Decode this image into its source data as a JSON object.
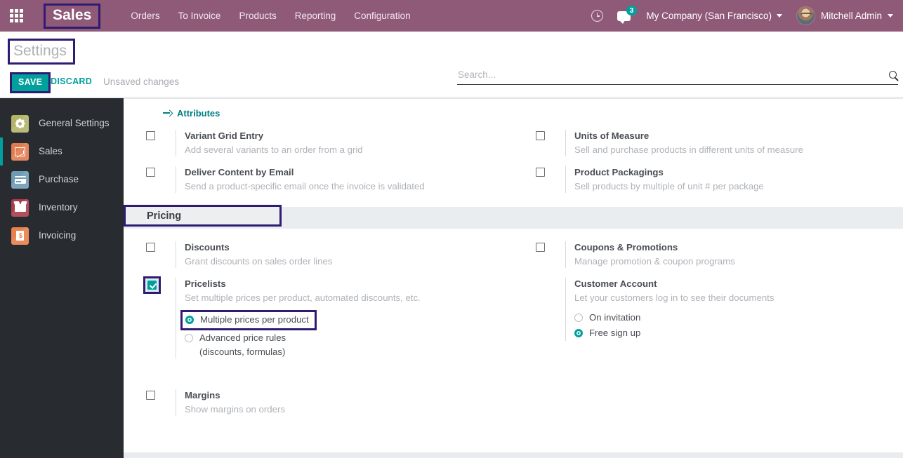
{
  "navbar": {
    "apps_icon": "apps-grid-icon",
    "brand": "Sales",
    "menu": [
      {
        "label": "Orders"
      },
      {
        "label": "To Invoice"
      },
      {
        "label": "Products"
      },
      {
        "label": "Reporting"
      },
      {
        "label": "Configuration"
      }
    ],
    "activity_icon": "clock-icon",
    "messages_icon": "chat-bubble-icon",
    "messages_count": "3",
    "company": "My Company (San Francisco)",
    "user": "Mitchell Admin",
    "accent_color": "#8f5a78",
    "badge_color": "#00a09d"
  },
  "control_panel": {
    "title": "Settings",
    "save_label": "SAVE",
    "discard_label": "DISCARD",
    "unsaved_note": "Unsaved changes",
    "search_placeholder": "Search...",
    "search_value": "",
    "search_icon": "magnifier-icon"
  },
  "sidebar": {
    "items": [
      {
        "label": "General Settings",
        "icon": "gear-icon",
        "active": false
      },
      {
        "label": "Sales",
        "icon": "sales-chart-icon",
        "active": true
      },
      {
        "label": "Purchase",
        "icon": "credit-card-icon",
        "active": false
      },
      {
        "label": "Inventory",
        "icon": "open-box-icon",
        "active": false
      },
      {
        "label": "Invoicing",
        "icon": "invoice-document-icon",
        "active": false
      }
    ],
    "active_marker_color": "#00a09d",
    "background_color": "#282b30"
  },
  "content": {
    "attributes_link": "Attributes",
    "attributes_icon": "arrow-right-icon",
    "products_settings": {
      "left": [
        {
          "title": "Variant Grid Entry",
          "desc": "Add several variants to an order from a grid",
          "checked": false
        },
        {
          "title": "Deliver Content by Email",
          "desc": "Send a product-specific email once the invoice is validated",
          "checked": false
        }
      ],
      "right": [
        {
          "title": "Units of Measure",
          "desc": "Sell and purchase products in different units of measure",
          "checked": false
        },
        {
          "title": "Product Packagings",
          "desc": "Sell products by multiple of unit # per package",
          "checked": false
        }
      ]
    },
    "pricing_section": {
      "title": "Pricing",
      "left": [
        {
          "title": "Discounts",
          "desc": "Grant discounts on sales order lines",
          "checked": false
        },
        {
          "title": "Pricelists",
          "desc": "Set multiple prices per product, automated discounts, etc.",
          "checked": true,
          "options": [
            {
              "label": "Multiple prices per product",
              "selected": true
            },
            {
              "label": "Advanced price rules",
              "sub": "(discounts, formulas)",
              "selected": false
            }
          ]
        },
        {
          "title": "Margins",
          "desc": "Show margins on orders",
          "checked": false
        }
      ],
      "right": [
        {
          "title": "Coupons & Promotions",
          "desc": "Manage promotion & coupon programs",
          "checked": false
        },
        {
          "title": "Customer Account",
          "desc": "Let your customers log in to see their documents",
          "options": [
            {
              "label": "On invitation",
              "selected": false
            },
            {
              "label": "Free sign up",
              "selected": true
            }
          ]
        }
      ]
    }
  }
}
